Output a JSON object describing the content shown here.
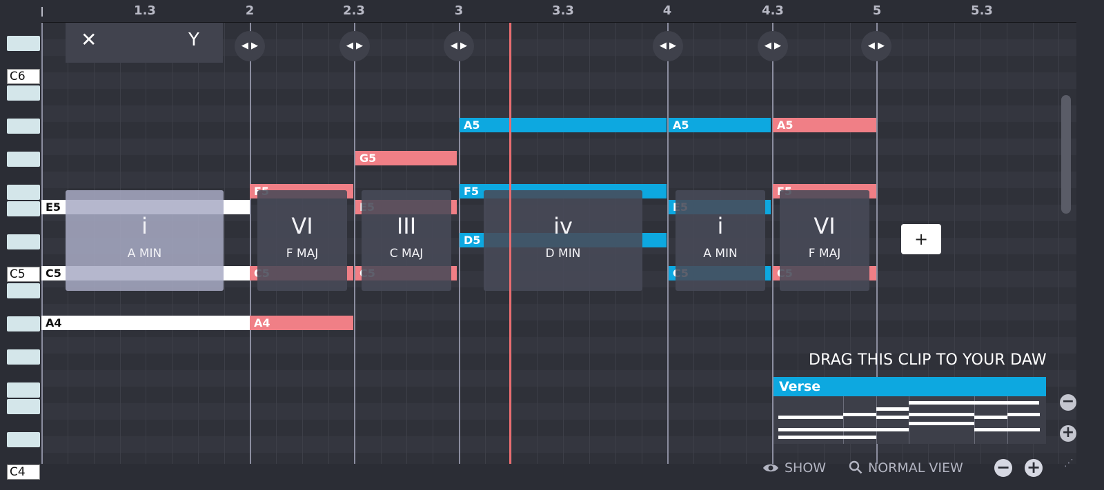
{
  "ruler": {
    "start_marker": "|",
    "labels": [
      "1.3",
      "2",
      "2.3",
      "3",
      "3.3",
      "4",
      "4.3",
      "5",
      "5.3"
    ]
  },
  "octave_labels": [
    "C6",
    "C5",
    "C4"
  ],
  "notes": [
    {
      "label": "E5",
      "style": "white"
    },
    {
      "label": "C5",
      "style": "white"
    },
    {
      "label": "A4",
      "style": "white"
    },
    {
      "label": "F5",
      "style": "red"
    },
    {
      "label": "C5",
      "style": "red"
    },
    {
      "label": "A4",
      "style": "red"
    },
    {
      "label": "G5",
      "style": "red"
    },
    {
      "label": "E5",
      "style": "red"
    },
    {
      "label": "C5",
      "style": "red"
    },
    {
      "label": "A5",
      "style": "blue"
    },
    {
      "label": "F5",
      "style": "blue"
    },
    {
      "label": "D5",
      "style": "blue"
    },
    {
      "label": "A5",
      "style": "blue"
    },
    {
      "label": "E5",
      "style": "blue"
    },
    {
      "label": "C5",
      "style": "blue"
    },
    {
      "label": "A5",
      "style": "red"
    },
    {
      "label": "F5",
      "style": "red"
    },
    {
      "label": "C5",
      "style": "red"
    }
  ],
  "chords": [
    {
      "numeral": "i",
      "name": "A MIN",
      "active": true
    },
    {
      "numeral": "VI",
      "name": "F MAJ",
      "active": false
    },
    {
      "numeral": "III",
      "name": "C MAJ",
      "active": false
    },
    {
      "numeral": "iv",
      "name": "D MIN",
      "active": false
    },
    {
      "numeral": "i",
      "name": "A MIN",
      "active": false
    },
    {
      "numeral": "VI",
      "name": "F MAJ",
      "active": false
    }
  ],
  "chord_toolbar": {
    "close_icon": "close-icon",
    "close_glyph": "✕",
    "fork_icon": "fork-icon",
    "fork_glyph": "Y"
  },
  "handle_glyph": "◀ ▶",
  "add_chord_label": "+",
  "drag_clip": {
    "hint": "DRAG THIS CLIP TO YOUR DAW",
    "clip_name": "Verse"
  },
  "footer": {
    "show_label": "SHOW",
    "view_label": "NORMAL VIEW",
    "zoom_out": "−",
    "zoom_in": "+"
  },
  "vertical_zoom": {
    "zoom_out": "−",
    "zoom_in": "+"
  },
  "colors": {
    "background": "#2b2d35",
    "note_red": "#f07f86",
    "note_blue": "#0da8e0",
    "playhead": "#e86c6f",
    "key": "#d4e6ea"
  }
}
